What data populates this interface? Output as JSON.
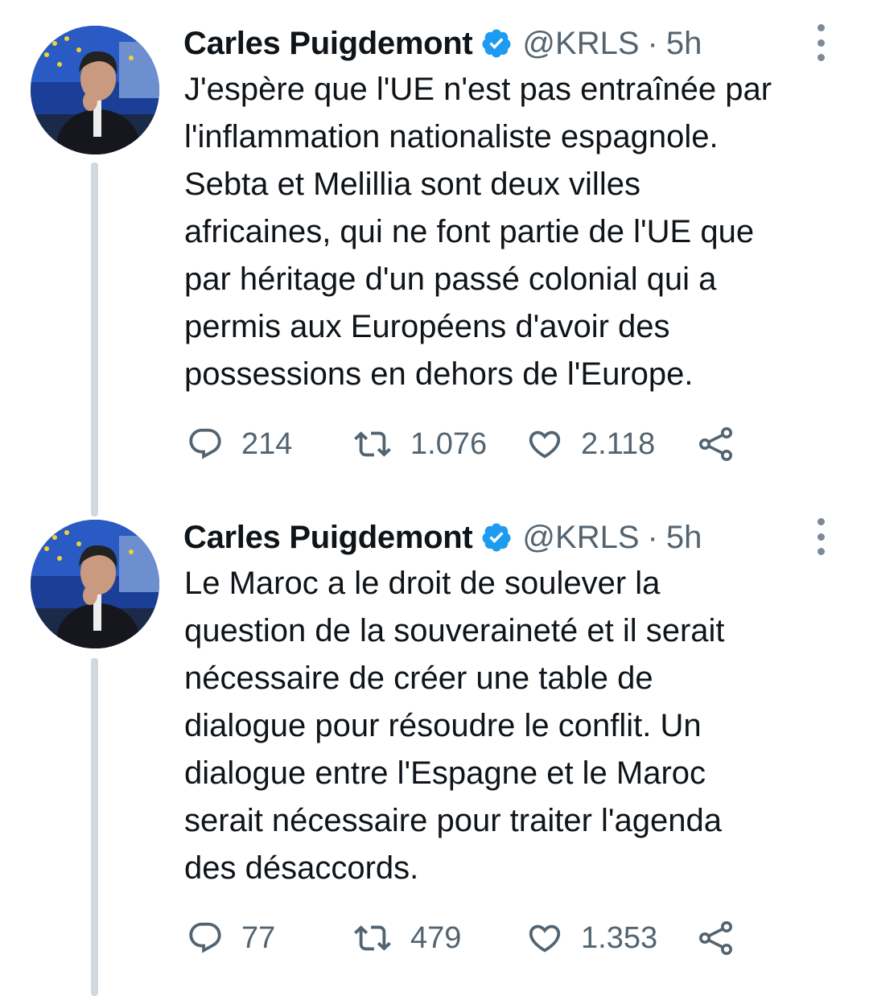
{
  "tweets": [
    {
      "author": {
        "name": "Carles Puigdemont",
        "handle": "@KRLS",
        "verified": true
      },
      "separator": "·",
      "time": "5h",
      "text": "J'espère que l'UE n'est pas entraînée par\nl'inflammation nationaliste espagnole.\nSebta et Melillia sont deux villes\nafricaines, qui ne font partie de l'UE que\npar héritage d'un passé colonial qui a\npermis aux Européens d'avoir des\npossessions en dehors de l'Europe.",
      "stats": {
        "replies": "214",
        "retweets": "1.076",
        "likes": "2.118"
      }
    },
    {
      "author": {
        "name": "Carles Puigdemont",
        "handle": "@KRLS",
        "verified": true
      },
      "separator": "·",
      "time": "5h",
      "text": "Le Maroc a le droit de soulever la\nquestion de la souveraineté et il serait\nnécessaire de créer une table de\ndialogue pour résoudre le conflit. Un\ndialogue entre l'Espagne et le Maroc\nserait nécessaire pour traiter l'agenda\ndes désaccords.",
      "stats": {
        "replies": "77",
        "retweets": "479",
        "likes": "1.353"
      }
    }
  ],
  "icons": {
    "reply": "speech-bubble-icon",
    "retweet": "retweet-arrows-icon",
    "like": "heart-icon",
    "share": "share-nodes-icon",
    "verified": "verified-badge-icon",
    "more": "vertical-ellipsis-icon"
  },
  "colors": {
    "text": "#0f1419",
    "secondary": "#536471",
    "verified": "#1d9bf0",
    "thread_line": "#cfd9de",
    "background": "#ffffff"
  }
}
